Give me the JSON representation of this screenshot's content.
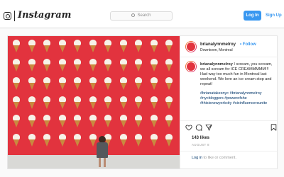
{
  "nav": {
    "logo": "Instagram",
    "search_placeholder": "Search",
    "login_label": "Log In",
    "signup_label": "Sign Up"
  },
  "post": {
    "username": "brianalynnmelroy",
    "follow_label": "Follow",
    "location": "Downtown, Montreal",
    "caption_user": "brianalynnmelroy",
    "caption_text": "I scream, you scream, we all scream for ICE CREAMMMMM!!! Had way too much fun in Montreal last weekend. We love an ice cream stop and repeat!",
    "caption_dots": ".\n.\n.\n.",
    "hashtags": "#brianatakesnyc #brianalynnmelroy #nycbloggers #powerofshe #thisisnewyorkcity #sixinfluencersunite",
    "likes": "143 likes",
    "date": "AUGUST 8",
    "login_link": "Log in",
    "login_suffix": "to like or comment."
  },
  "icons": {
    "camera": "camera-icon",
    "search": "search-icon",
    "heart": "heart-icon",
    "comment": "comment-icon",
    "share": "share-icon",
    "save": "bookmark-icon"
  },
  "colors": {
    "accent": "#3897f0",
    "wall": "#e2333e",
    "cone": "#c9893f",
    "link": "#003569"
  }
}
